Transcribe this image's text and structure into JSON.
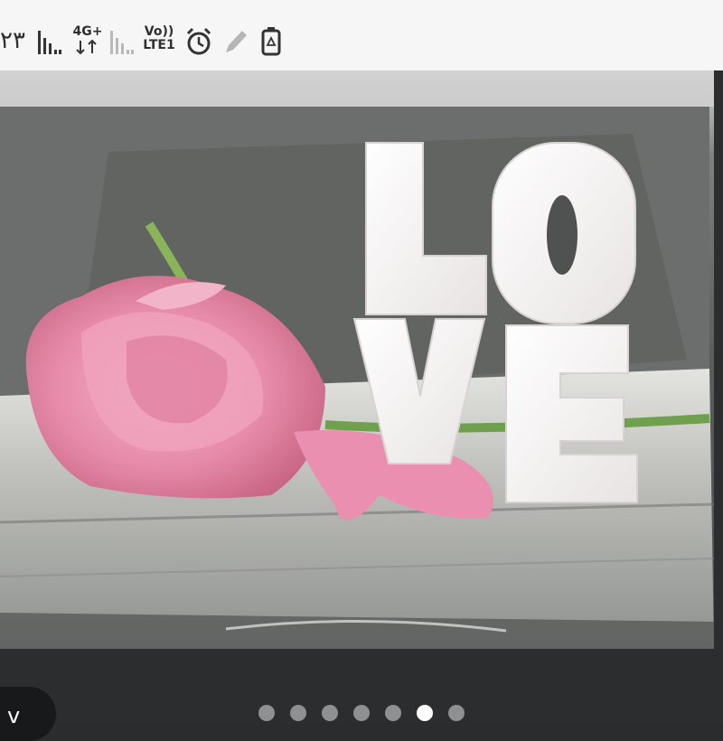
{
  "status_bar": {
    "clock_text": "۲۳",
    "network_type": "4G+",
    "volte_line1": "Vo))",
    "volte_line2": "LTE1",
    "icons": [
      "signal-strength-icon",
      "data-4g-icon",
      "signal-weak-icon",
      "volte-icon",
      "alarm-icon",
      "pencil-icon",
      "battery-recycle-icon"
    ]
  },
  "photo": {
    "letters": [
      "L",
      "O",
      "V",
      "E"
    ],
    "description_icon": "image"
  },
  "gallery": {
    "page_count": 7,
    "active_index": 5
  },
  "back_button": {
    "label": "v"
  },
  "colors": {
    "status_bar_bg": "#f6f6f6",
    "bottom_bg": "#2b2d2e",
    "dot_inactive": "#8e9091",
    "dot_active": "#ffffff",
    "rose": "#e78fae"
  }
}
